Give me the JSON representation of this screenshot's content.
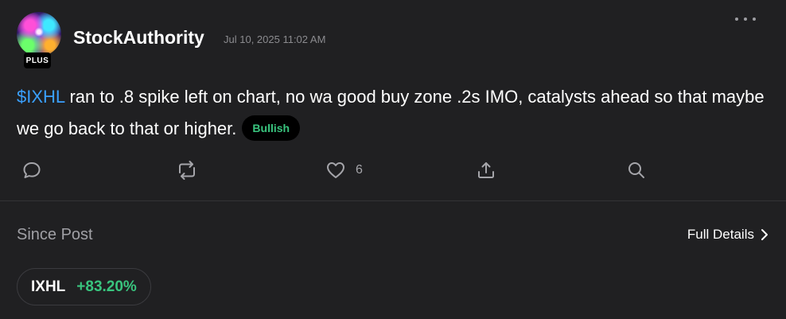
{
  "author": {
    "username": "StockAuthority",
    "badge": "PLUS",
    "timestamp": "Jul 10, 2025 11:02 AM"
  },
  "post": {
    "cashtag": "$IXHL",
    "text": " ran to .8 spike left on chart, no wa good buy zone .2s IMO, catalysts ahead so that maybe we go back to that or higher.",
    "sentiment": "Bullish"
  },
  "actions": {
    "reply_icon": "comment-icon",
    "repost_icon": "repost-icon",
    "like_icon": "heart-icon",
    "like_count": "6",
    "share_icon": "share-icon",
    "search_icon": "search-icon"
  },
  "performance": {
    "label": "Since Post",
    "details_link": "Full Details",
    "ticker": "IXHL",
    "change": "+83.20%"
  },
  "colors": {
    "background": "#202022",
    "cashtag": "#3aa0ff",
    "positive": "#39c47e",
    "muted": "#a0a0a5"
  }
}
